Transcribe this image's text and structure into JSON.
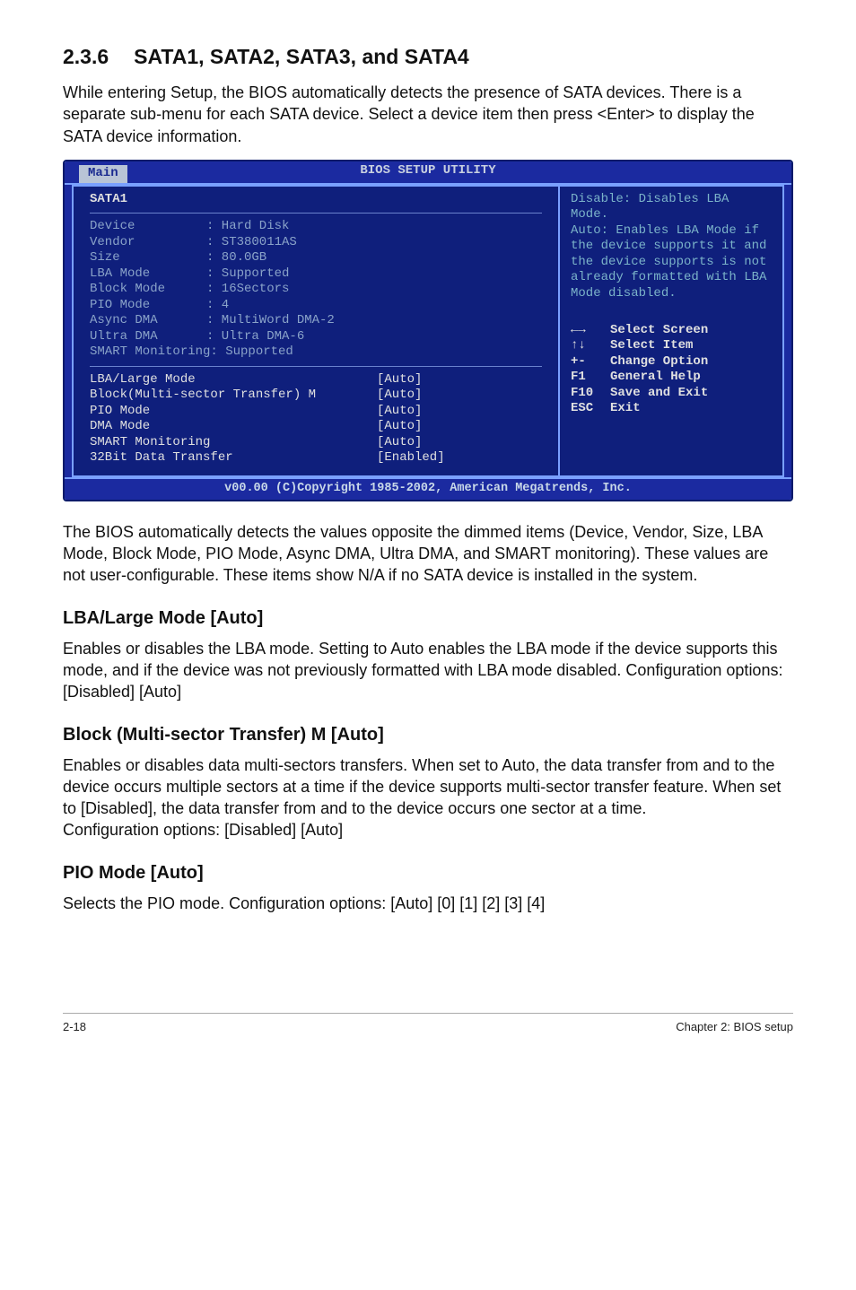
{
  "heading_num": "2.3.6",
  "heading_title": "SATA1, SATA2, SATA3, and SATA4",
  "intro": "While entering Setup, the BIOS automatically detects the presence of SATA devices. There is a separate sub-menu for each SATA device. Select a device item then press <Enter> to display the SATA device information.",
  "bios": {
    "title": "BIOS SETUP UTILITY",
    "tab": "Main",
    "section": "SATA1",
    "info": [
      {
        "k": "Device",
        "v": ": Hard Disk"
      },
      {
        "k": "Vendor",
        "v": ": ST380011AS"
      },
      {
        "k": "Size",
        "v": ": 80.0GB"
      },
      {
        "k": "LBA Mode",
        "v": ": Supported"
      },
      {
        "k": "Block Mode",
        "v": ": 16Sectors"
      },
      {
        "k": "PIO Mode",
        "v": ": 4"
      },
      {
        "k": "Async DMA",
        "v": ": MultiWord DMA-2"
      },
      {
        "k": "Ultra DMA",
        "v": ": Ultra DMA-6"
      },
      {
        "k": "SMART Monitoring: Supported",
        "v": ""
      }
    ],
    "opts": [
      {
        "k": "LBA/Large Mode",
        "v": "[Auto]"
      },
      {
        "k": "Block(Multi-sector Transfer) M",
        "v": "[Auto]"
      },
      {
        "k": "PIO Mode",
        "v": "[Auto]"
      },
      {
        "k": "DMA Mode",
        "v": "[Auto]"
      },
      {
        "k": "SMART Monitoring",
        "v": "[Auto]"
      },
      {
        "k": "32Bit Data Transfer",
        "v": "[Enabled]"
      }
    ],
    "help": "Disable: Disables LBA Mode.\nAuto: Enables LBA Mode if the device supports it and the device supports is not already formatted with LBA Mode disabled.",
    "nav": [
      {
        "key": "←→",
        "label": "Select Screen"
      },
      {
        "key": "↑↓",
        "label": "Select Item"
      },
      {
        "key": "+-",
        "label": "Change Option"
      },
      {
        "key": "F1",
        "label": "General Help"
      },
      {
        "key": "F10",
        "label": "Save and Exit"
      },
      {
        "key": "ESC",
        "label": "Exit"
      }
    ],
    "footer": "v00.00 (C)Copyright 1985-2002, American Megatrends, Inc."
  },
  "post_bios": "The BIOS automatically detects the values opposite the dimmed items (Device, Vendor, Size, LBA Mode, Block Mode, PIO Mode, Async DMA, Ultra DMA, and SMART monitoring). These values are not user-configurable. These items show N/A if no SATA device is installed in the system.",
  "lba_h": "LBA/Large Mode [Auto]",
  "lba_p": "Enables or disables the LBA mode. Setting to Auto enables the LBA mode if the device supports this mode, and if the device was not previously formatted with LBA mode disabled. Configuration options: [Disabled] [Auto]",
  "block_h": "Block (Multi-sector Transfer) M [Auto]",
  "block_p1": "Enables or disables data multi-sectors transfers. When set to Auto, the data transfer from and to the device occurs multiple sectors at a time if the device supports multi-sector transfer feature. When set to [Disabled], the data transfer from and to the device occurs one sector at a time.",
  "block_p2": "Configuration options: [Disabled] [Auto]",
  "pio_h": "PIO Mode [Auto]",
  "pio_p": "Selects the PIO mode. Configuration options: [Auto] [0] [1] [2] [3] [4]",
  "footer_left": "2-18",
  "footer_right": "Chapter 2: BIOS setup"
}
